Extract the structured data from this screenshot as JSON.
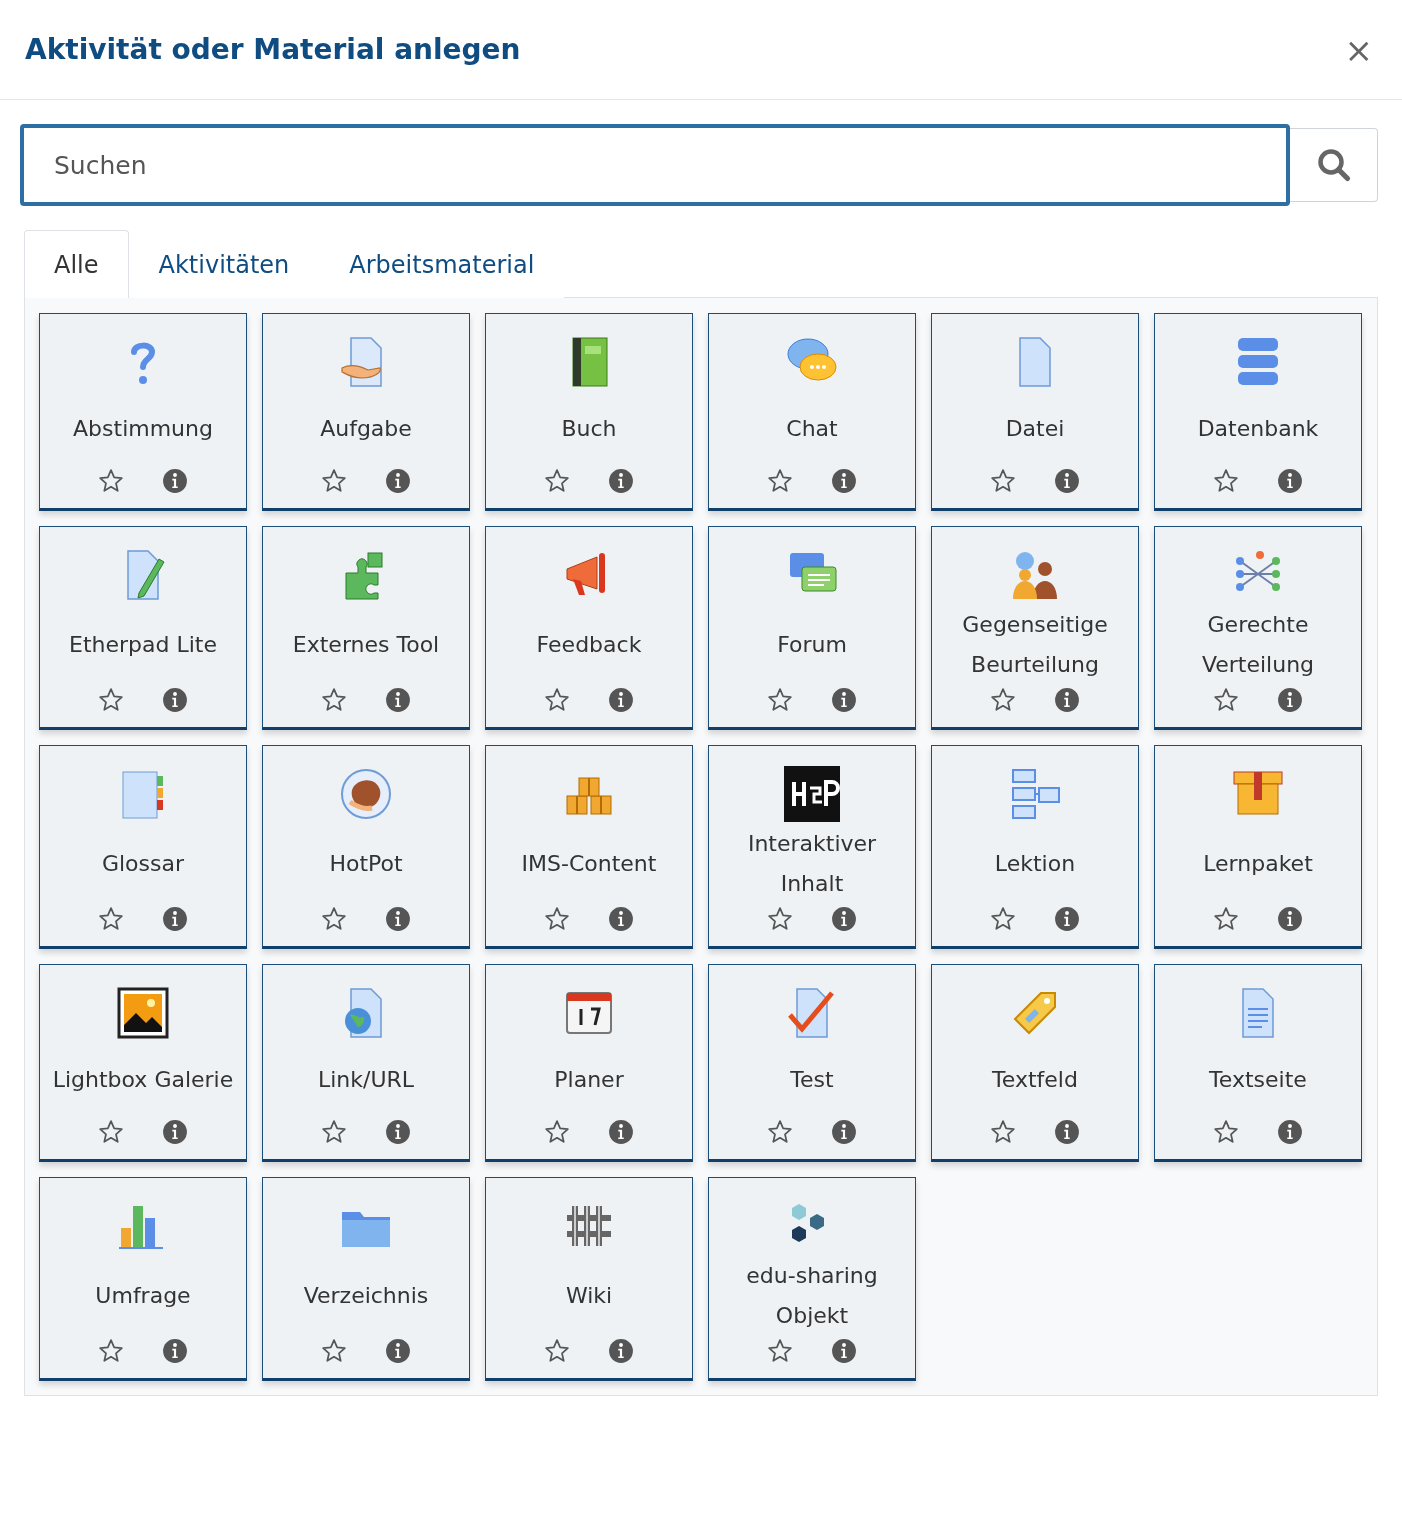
{
  "dialog": {
    "title": "Aktivität oder Material anlegen",
    "close": "×"
  },
  "search": {
    "placeholder": "Suchen"
  },
  "tabs": [
    {
      "label": "Alle",
      "selected": true
    },
    {
      "label": "Aktivitäten",
      "selected": false
    },
    {
      "label": "Arbeitsmaterial",
      "selected": false
    }
  ],
  "items": [
    {
      "label": "Abstimmung",
      "starred": false
    },
    {
      "label": "Aufgabe",
      "starred": false
    },
    {
      "label": "Buch",
      "starred": false
    },
    {
      "label": "Chat",
      "starred": false
    },
    {
      "label": "Datei",
      "starred": false
    },
    {
      "label": "Datenbank",
      "starred": false
    },
    {
      "label": "Etherpad Lite",
      "starred": false
    },
    {
      "label": "Externes Tool",
      "starred": false
    },
    {
      "label": "Feedback",
      "starred": false
    },
    {
      "label": "Forum",
      "starred": false
    },
    {
      "label": "Gegenseitige Beurteilung",
      "starred": false
    },
    {
      "label": "Gerechte Verteilung",
      "starred": false
    },
    {
      "label": "Glossar",
      "starred": false
    },
    {
      "label": "HotPot",
      "starred": false
    },
    {
      "label": "IMS-Content",
      "starred": false
    },
    {
      "label": "Interaktiver Inhalt",
      "starred": false
    },
    {
      "label": "Lektion",
      "starred": false
    },
    {
      "label": "Lernpaket",
      "starred": false
    },
    {
      "label": "Lightbox Galerie",
      "starred": false
    },
    {
      "label": "Link/URL",
      "starred": false
    },
    {
      "label": "Planer",
      "starred": false
    },
    {
      "label": "Test",
      "starred": false
    },
    {
      "label": "Textfeld",
      "starred": false
    },
    {
      "label": "Textseite",
      "starred": false
    },
    {
      "label": "Umfrage",
      "starred": false
    },
    {
      "label": "Verzeichnis",
      "starred": false
    },
    {
      "label": "Wiki",
      "starred": false
    },
    {
      "label": "edu-sharing Objekt",
      "starred": false
    }
  ]
}
